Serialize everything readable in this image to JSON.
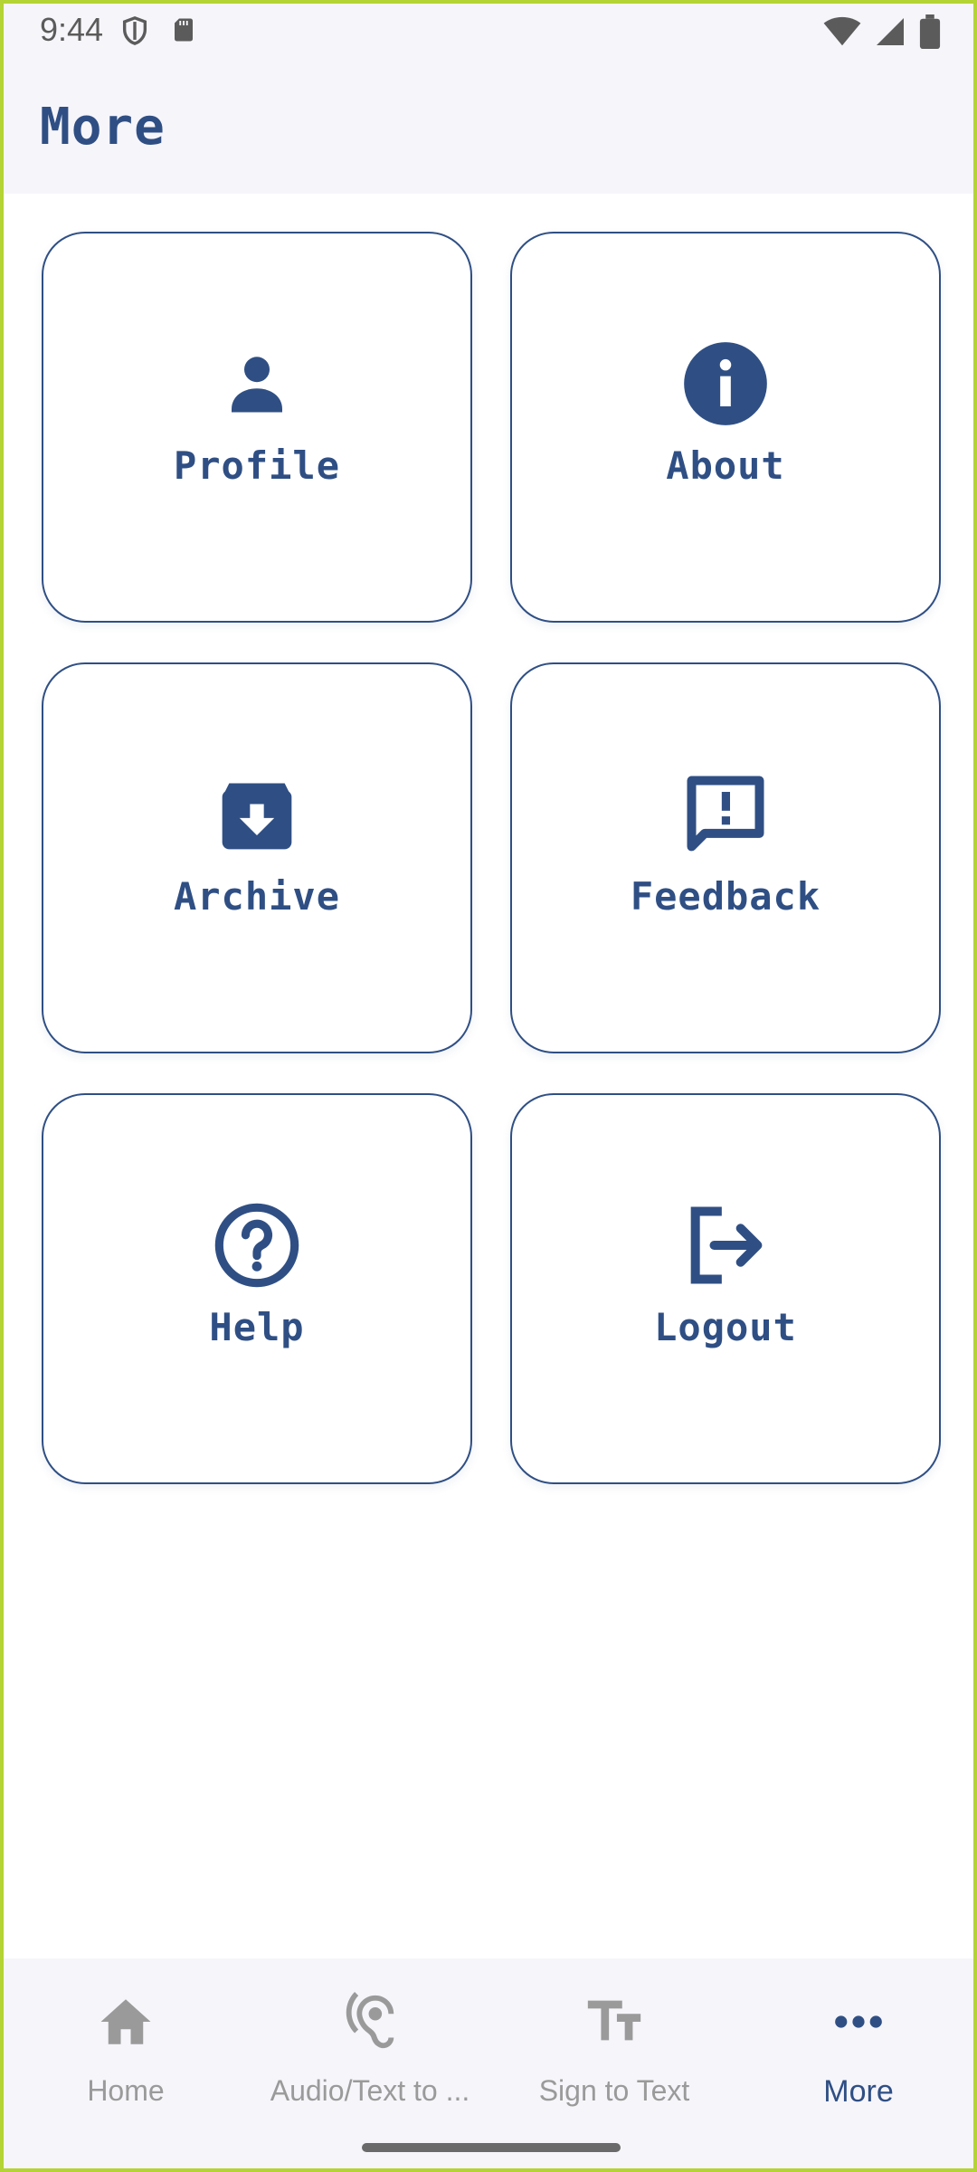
{
  "status_bar": {
    "time": "9:44",
    "icons": [
      "shield-icon",
      "sd-card-icon",
      "wifi-icon",
      "signal-icon",
      "battery-icon"
    ]
  },
  "app_bar": {
    "title": "More"
  },
  "cards": [
    {
      "label": "Profile",
      "icon": "person-icon"
    },
    {
      "label": "About",
      "icon": "info-icon"
    },
    {
      "label": "Archive",
      "icon": "archive-icon"
    },
    {
      "label": "Feedback",
      "icon": "feedback-icon"
    },
    {
      "label": "Help",
      "icon": "help-icon"
    },
    {
      "label": "Logout",
      "icon": "logout-icon"
    }
  ],
  "bottom_nav": {
    "items": [
      {
        "label": "Home",
        "icon": "home-icon",
        "active": false
      },
      {
        "label": "Audio/Text to ...",
        "icon": "hearing-icon",
        "active": false
      },
      {
        "label": "Sign to Text",
        "icon": "text-fields-icon",
        "active": false
      },
      {
        "label": "More",
        "icon": "more-horiz-icon",
        "active": true
      }
    ]
  },
  "colors": {
    "primary": "#2f4f84",
    "inactive": "#9a9a9a",
    "surface": "#f6f5fa",
    "frame": "#b4d334"
  }
}
